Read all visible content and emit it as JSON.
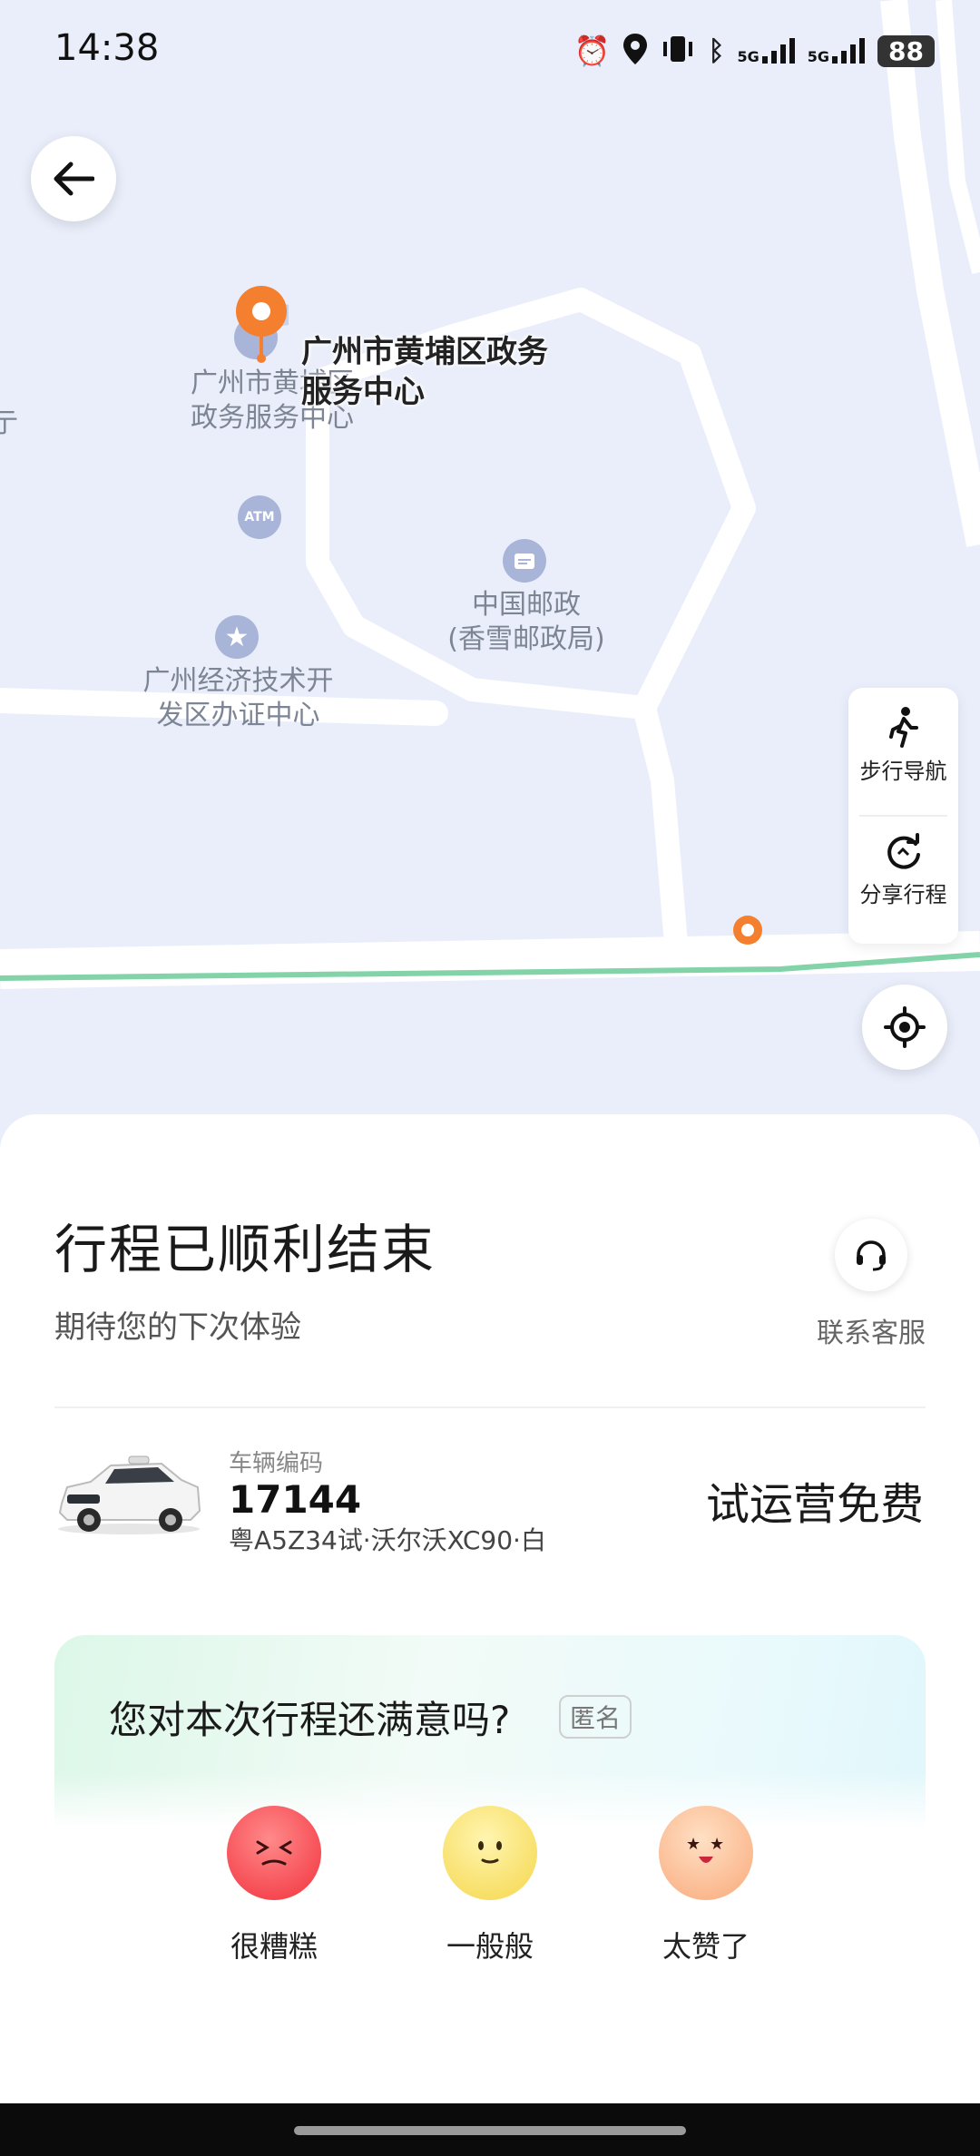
{
  "status_bar": {
    "time": "14:38",
    "battery": "88",
    "signal_1": "5G",
    "signal_2": "5G"
  },
  "map": {
    "destination_name": "广州市黄埔区政务服务中心",
    "destination_line1": "广州市黄埔区政务",
    "destination_line2": "服务中心",
    "poi_service_center_1": "广州市黄埔区",
    "poi_service_center_2": "政务服务中心",
    "poi_atm": "ATM",
    "poi_post_1": "中国邮政",
    "poi_post_2": "(香雪邮政局)",
    "poi_office_1": "广州经济技术开",
    "poi_office_2": "发区办证中心",
    "edge_char": "亍"
  },
  "side_actions": {
    "walk_nav": "步行导航",
    "share_trip": "分享行程"
  },
  "trip": {
    "title": "行程已顺利结束",
    "subtitle": "期待您的下次体验",
    "customer_service": "联系客服"
  },
  "vehicle": {
    "label": "车辆编码",
    "number": "17144",
    "description": "粤A5Z34试·沃尔沃XC90·白",
    "fare_text": "试运营免费"
  },
  "rating": {
    "question": "您对本次行程还满意吗?",
    "anonymous_tag": "匿名",
    "options": [
      "很糟糕",
      "一般般",
      "太赞了"
    ]
  },
  "colors": {
    "accent_orange": "#f47f2e",
    "map_bg": "#e9eefa",
    "route_green": "#82d3a8"
  },
  "icons": [
    "arrow-left-icon",
    "location-pin-icon",
    "atm-icon",
    "post-icon",
    "star-icon",
    "walk-icon",
    "share-icon",
    "locate-icon",
    "headset-icon"
  ]
}
